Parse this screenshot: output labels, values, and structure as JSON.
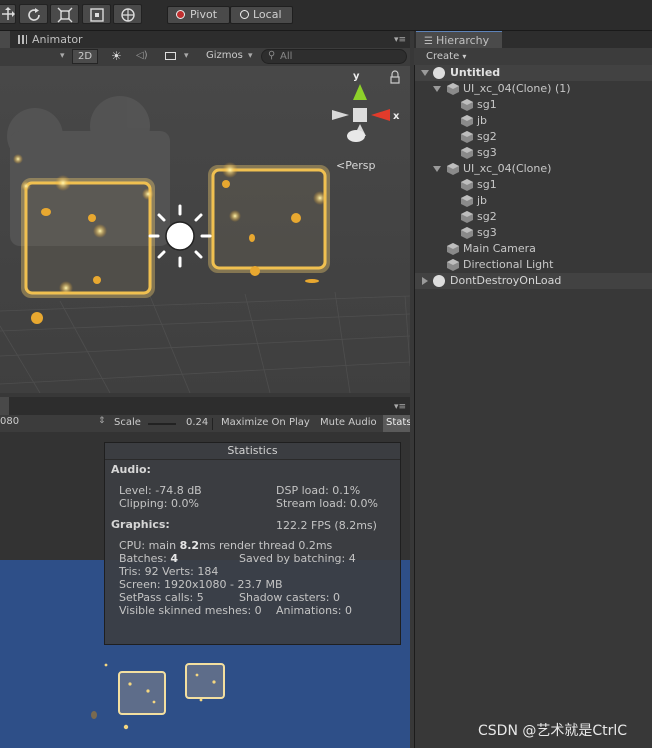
{
  "toolbar": {
    "pivot_label": "Pivot",
    "local_label": "Local",
    "tool_icons": [
      "hand-icon",
      "move-icon",
      "rotate-icon",
      "scale-icon",
      "rect-icon",
      "transform-icon"
    ]
  },
  "scene": {
    "tab_label": "Animator",
    "mode_2d": "2D",
    "gizmos_label": "Gizmos",
    "search_placeholder": "All",
    "persp_label": "Persp",
    "axis_y": "y",
    "axis_x": "x"
  },
  "game": {
    "resolution_fragment": "080",
    "scale_label": "Scale",
    "scale_value": "0.24",
    "maximize_label": "Maximize On Play",
    "mute_label": "Mute Audio",
    "stats_label": "Stats",
    "background_color": "#2d4f8a"
  },
  "stats": {
    "title": "Statistics",
    "audio_heading": "Audio:",
    "level": "Level: -74.8 dB",
    "clipping": "Clipping: 0.0%",
    "dsp_load": "DSP load: 0.1%",
    "stream_load": "Stream load: 0.0%",
    "graphics_heading": "Graphics:",
    "fps": "122.2 FPS (8.2ms)",
    "cpu_prefix": "CPU: main ",
    "cpu_main": "8.2",
    "cpu_suffix": "ms  render thread 0.2ms",
    "batches_prefix": "Batches: ",
    "batches_value": "4",
    "saved_by_batching": "Saved by batching: 4",
    "tris_verts": "Tris: 92   Verts: 184",
    "screen": "Screen: 1920x1080 - 23.7 MB",
    "setpass": "SetPass calls: 5",
    "shadow_casters": "Shadow casters: 0",
    "skinned_meshes": "Visible skinned meshes: 0",
    "animations": "Animations: 0"
  },
  "hierarchy": {
    "tab_label": "Hierarchy",
    "create_label": "Create",
    "scene_name": "Untitled",
    "clone1_name": "UI_xc_04(Clone) (1)",
    "clone1_children": [
      "sg1",
      "jb",
      "sg2",
      "sg3"
    ],
    "clone2_name": "UI_xc_04(Clone)",
    "clone2_children": [
      "sg1",
      "jb",
      "sg2",
      "sg3"
    ],
    "main_camera": "Main Camera",
    "directional_light": "Directional Light",
    "dont_destroy": "DontDestroyOnLoad"
  },
  "watermark": "CSDN @艺术就是CtrlC"
}
